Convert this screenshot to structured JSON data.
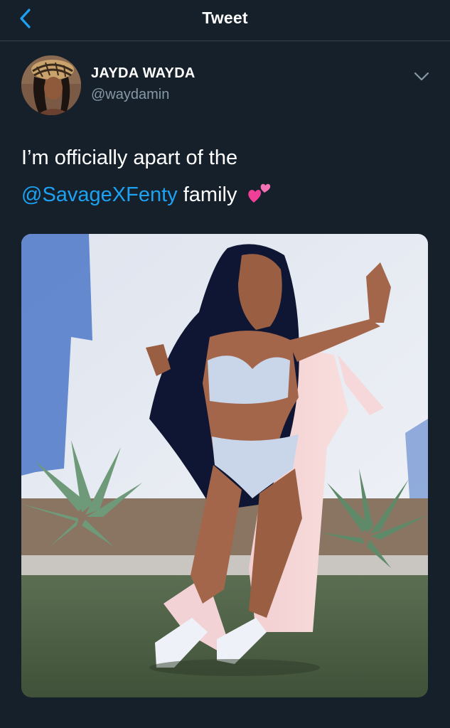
{
  "header": {
    "title": "Tweet",
    "back_icon": "chevron-left-icon"
  },
  "tweet": {
    "author": {
      "display_name": "JAYDA WAYDA",
      "handle": "@waydamin"
    },
    "text": {
      "before_mention": "I’m officially apart of the",
      "mention": "@SavageXFenty",
      "after_mention": " family",
      "emoji": "two-hearts"
    },
    "media": {
      "type": "photo"
    }
  },
  "colors": {
    "background": "#15202b",
    "divider": "#38444d",
    "accent": "#1da1f2",
    "secondary_text": "#8899a6"
  }
}
